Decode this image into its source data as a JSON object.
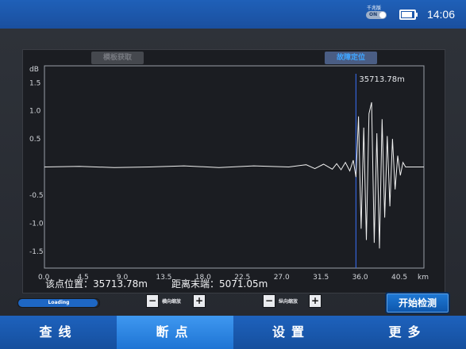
{
  "status": {
    "time": "14:06",
    "gigabit_label": "千兆版",
    "toggle_text": "ON"
  },
  "toolbar": {
    "capture_label": "模板获取",
    "locate_label": "故障定位"
  },
  "info": {
    "point_label": "该点位置：",
    "point_value": "35713.78m",
    "end_label": "距离末端：",
    "end_value": "5071.05m"
  },
  "controls": {
    "loading_text": "Loading",
    "loading_progress": 0.98,
    "h_zoom_label": "横向缩放",
    "v_zoom_label": "纵向缩放",
    "minus": "−",
    "plus": "+",
    "start_label": "开始检测"
  },
  "nav": {
    "items": [
      "查线",
      "断点",
      "设置",
      "更多"
    ],
    "active_index": 1
  },
  "colors": {
    "accent": "#1e74d4",
    "trace": "#f0f0f0",
    "cursor": "#3563d6"
  },
  "chart_data": {
    "type": "line",
    "ylabel": "dB",
    "xlabel": "km",
    "xlim": [
      0,
      43.5
    ],
    "ylim": [
      -1.8,
      1.8
    ],
    "x_ticks": [
      "0.0",
      "4.5",
      "9.0",
      "13.5",
      "18.0",
      "22.5",
      "27.0",
      "31.5",
      "36.0",
      "40.5",
      "km"
    ],
    "y_ticks": [
      "dB",
      "1.5",
      "1.0",
      "0.5",
      "-0.5",
      "-1.0",
      "-1.5"
    ],
    "cursor": {
      "x": 35.71,
      "label": "35713.78m"
    },
    "series": [
      {
        "x": [
          0,
          4,
          8,
          12,
          16,
          20,
          24,
          28,
          30,
          31,
          32,
          33,
          33.5,
          34,
          34.5,
          35,
          35.4,
          35.71,
          36.0,
          36.3,
          36.6,
          36.9,
          37.2,
          37.5,
          37.8,
          38.1,
          38.4,
          38.7,
          39.0,
          39.3,
          39.6,
          39.9,
          40.2,
          40.5,
          40.8,
          41.1,
          41.4,
          41.7,
          42.0,
          43.5
        ],
        "values": [
          0.0,
          0.01,
          -0.01,
          0.0,
          0.02,
          -0.01,
          0.02,
          0.0,
          0.04,
          -0.03,
          0.05,
          -0.04,
          0.06,
          -0.05,
          0.08,
          -0.07,
          0.12,
          -0.18,
          0.9,
          -1.1,
          0.7,
          -1.3,
          0.95,
          1.15,
          -1.35,
          0.6,
          -1.45,
          0.85,
          -0.9,
          0.55,
          -0.7,
          0.5,
          -0.4,
          0.2,
          -0.15,
          0.08,
          0.0,
          0.0,
          0.0,
          0.0
        ]
      }
    ]
  }
}
